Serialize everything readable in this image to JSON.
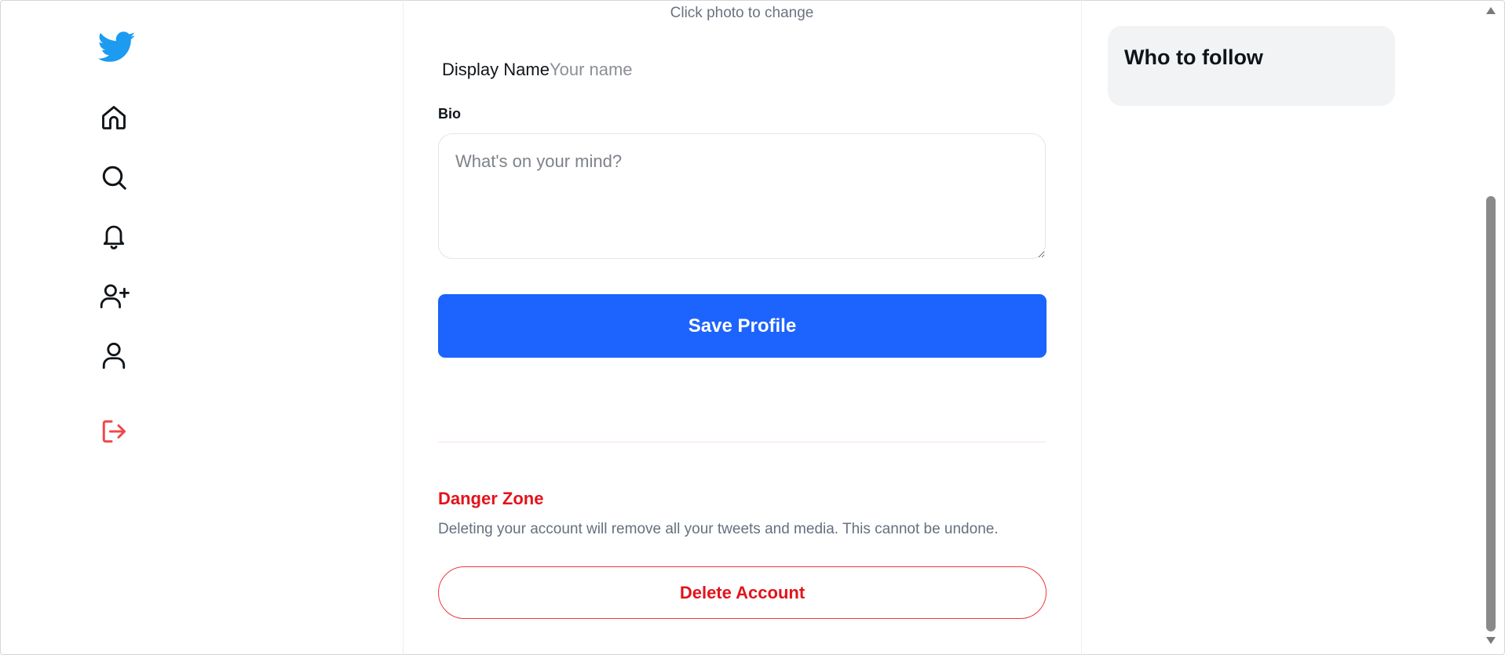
{
  "colors": {
    "brand": "#1d9bf0",
    "primary_button": "#1d63fe",
    "danger": "#e3131b",
    "logout_icon": "#f04848",
    "muted_text": "#6b7280",
    "card_bg": "#f2f3f5"
  },
  "sidebar": {
    "logo_icon": "twitter-bird-icon",
    "items": [
      {
        "name": "home",
        "icon": "home-icon"
      },
      {
        "name": "explore",
        "icon": "search-icon"
      },
      {
        "name": "notifications",
        "icon": "bell-icon"
      },
      {
        "name": "follow",
        "icon": "user-plus-icon"
      },
      {
        "name": "profile",
        "icon": "user-icon"
      },
      {
        "name": "logout",
        "icon": "logout-icon"
      }
    ]
  },
  "profile_form": {
    "photo_caption": "Click photo to change",
    "display_name": {
      "label": "Display Name",
      "value": "",
      "placeholder": "Your name"
    },
    "bio": {
      "label": "Bio",
      "value": "",
      "placeholder": "What's on your mind?"
    },
    "save_label": "Save Profile"
  },
  "danger_zone": {
    "title": "Danger Zone",
    "description": "Deleting your account will remove all your tweets and media. This cannot be undone.",
    "delete_label": "Delete Account"
  },
  "right_panel": {
    "who_to_follow_title": "Who to follow"
  }
}
